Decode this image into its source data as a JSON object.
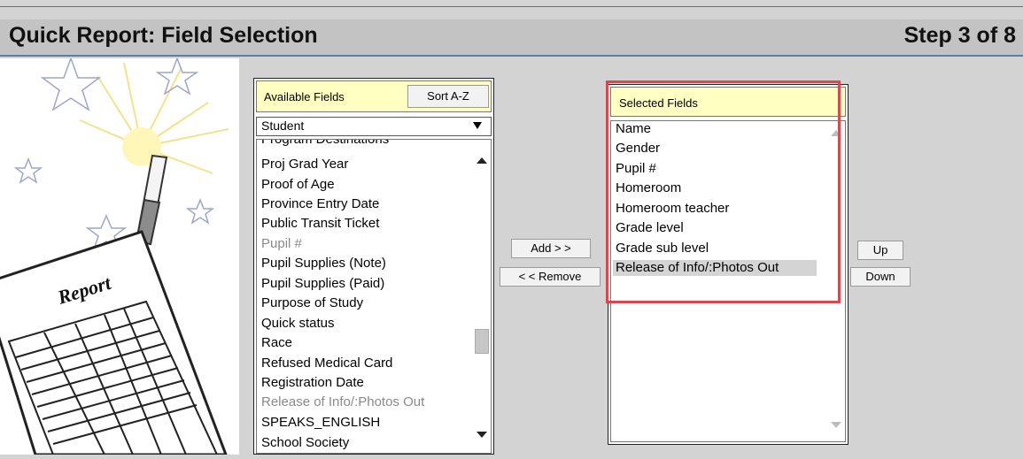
{
  "header": {
    "title": "Quick Report: Field Selection",
    "step": "Step 3 of 8"
  },
  "illustration": {
    "report_label": "Report"
  },
  "available": {
    "header_label": "Available Fields",
    "sort_button": "Sort A-Z",
    "table_select_value": "Student",
    "partial_top_item": "Program Destinations",
    "items": [
      {
        "label": "Proj Grad Year",
        "state": "normal"
      },
      {
        "label": "Proof of Age",
        "state": "normal"
      },
      {
        "label": "Province Entry Date",
        "state": "normal"
      },
      {
        "label": "Public Transit Ticket",
        "state": "normal"
      },
      {
        "label": "Pupil #",
        "state": "disabled"
      },
      {
        "label": "Pupil Supplies (Note)",
        "state": "normal"
      },
      {
        "label": "Pupil Supplies (Paid)",
        "state": "normal"
      },
      {
        "label": "Purpose of Study",
        "state": "normal"
      },
      {
        "label": "Quick status",
        "state": "normal"
      },
      {
        "label": "Race",
        "state": "normal"
      },
      {
        "label": "Refused Medical Card",
        "state": "normal"
      },
      {
        "label": "Registration Date",
        "state": "normal"
      },
      {
        "label": "Release of Info/:Photos Out",
        "state": "disabled"
      },
      {
        "label": "SPEAKS_ENGLISH",
        "state": "normal"
      }
    ],
    "partial_bottom_item": "School Society"
  },
  "actions": {
    "add": "Add > >",
    "remove": "< < Remove"
  },
  "selected": {
    "header_label": "Selected Fields",
    "items": [
      {
        "label": "Name",
        "state": "normal"
      },
      {
        "label": "Gender",
        "state": "normal"
      },
      {
        "label": "Pupil #",
        "state": "normal"
      },
      {
        "label": "Homeroom",
        "state": "normal"
      },
      {
        "label": "Homeroom teacher",
        "state": "normal"
      },
      {
        "label": "Grade level",
        "state": "normal"
      },
      {
        "label": "Grade sub level",
        "state": "normal"
      },
      {
        "label": "Release of Info/:Photos Out",
        "state": "selected"
      }
    ]
  },
  "order": {
    "up": "Up",
    "down": "Down"
  },
  "colors": {
    "panel_header_bg": "#ffffc2",
    "highlight_border": "#e0454b",
    "page_bg": "#d3d3d3",
    "header_underline": "#5c7caa"
  }
}
